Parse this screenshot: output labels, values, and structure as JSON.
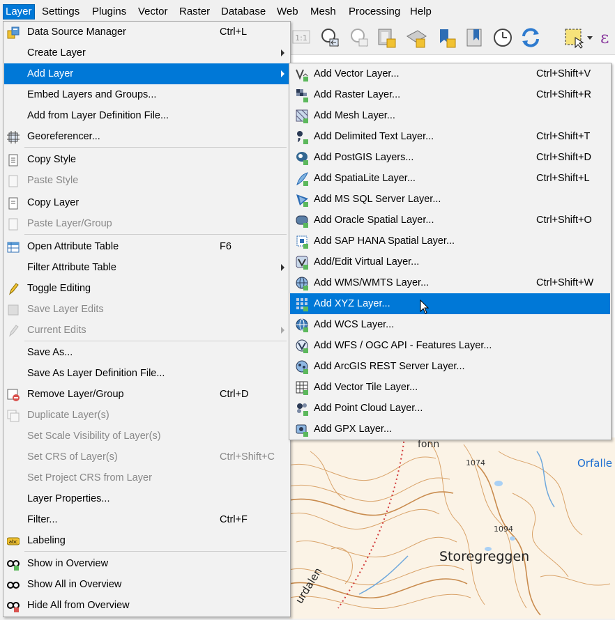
{
  "menubar": {
    "items": [
      {
        "label": "Layer",
        "active": true
      },
      {
        "label": "Settings"
      },
      {
        "label": "Plugins"
      },
      {
        "label": "Vector"
      },
      {
        "label": "Raster"
      },
      {
        "label": "Database"
      },
      {
        "label": "Web"
      },
      {
        "label": "Mesh"
      },
      {
        "label": "Processing"
      },
      {
        "label": "Help"
      }
    ]
  },
  "toolbar": {
    "icons": [
      "zoom-native-icon",
      "zoom-last-icon",
      "zoom-next-icon",
      "new-bookmark-icon",
      "show-bookmarks-icon",
      "new-spatial-bookmark-icon",
      "bookmarks-panel-icon",
      "temporal-controller-icon",
      "refresh-icon",
      "select-features-icon",
      "dropdown-icon",
      "expression-icon"
    ],
    "zoom_label": "1:1"
  },
  "layer_menu": {
    "items": [
      {
        "label": "Data Source Manager",
        "shortcut": "Ctrl+L",
        "icon": "data-source-manager-icon",
        "state": "normal"
      },
      {
        "label": "Create Layer",
        "submenu": true,
        "state": "normal"
      },
      {
        "label": "Add Layer",
        "submenu": true,
        "state": "highlighted"
      },
      {
        "label": "Embed Layers and Groups...",
        "state": "normal"
      },
      {
        "label": "Add from Layer Definition File...",
        "state": "normal"
      },
      {
        "label": "Georeferencer...",
        "icon": "georeferencer-icon",
        "state": "normal"
      },
      {
        "label": "Copy Style",
        "icon": "copy-style-icon",
        "state": "normal"
      },
      {
        "label": "Paste Style",
        "icon": "paste-style-icon",
        "state": "disabled"
      },
      {
        "label": "Copy Layer",
        "icon": "copy-layer-icon",
        "state": "normal"
      },
      {
        "label": "Paste Layer/Group",
        "icon": "paste-layer-icon",
        "state": "disabled"
      },
      {
        "label": "Open Attribute Table",
        "shortcut": "F6",
        "icon": "attribute-table-icon",
        "state": "normal"
      },
      {
        "label": "Filter Attribute Table",
        "submenu": true,
        "state": "normal"
      },
      {
        "label": "Toggle Editing",
        "icon": "pencil-icon",
        "state": "normal"
      },
      {
        "label": "Save Layer Edits",
        "icon": "save-edits-icon",
        "state": "disabled"
      },
      {
        "label": "Current Edits",
        "icon": "current-edits-icon",
        "submenu": true,
        "state": "disabled"
      },
      {
        "label": "Save As...",
        "state": "normal"
      },
      {
        "label": "Save As Layer Definition File...",
        "state": "normal"
      },
      {
        "label": "Remove Layer/Group",
        "shortcut": "Ctrl+D",
        "icon": "remove-layer-icon",
        "state": "normal"
      },
      {
        "label": "Duplicate Layer(s)",
        "icon": "duplicate-layer-icon",
        "state": "disabled"
      },
      {
        "label": "Set Scale Visibility of Layer(s)",
        "state": "disabled"
      },
      {
        "label": "Set CRS of Layer(s)",
        "shortcut": "Ctrl+Shift+C",
        "state": "disabled"
      },
      {
        "label": "Set Project CRS from Layer",
        "state": "disabled"
      },
      {
        "label": "Layer Properties...",
        "state": "normal"
      },
      {
        "label": "Filter...",
        "shortcut": "Ctrl+F",
        "state": "normal"
      },
      {
        "label": "Labeling",
        "icon": "labeling-icon",
        "state": "normal"
      },
      {
        "label": "Show in Overview",
        "icon": "show-overview-icon",
        "state": "normal"
      },
      {
        "label": "Show All in Overview",
        "icon": "show-all-overview-icon",
        "state": "normal"
      },
      {
        "label": "Hide All from Overview",
        "icon": "hide-all-overview-icon",
        "state": "normal"
      }
    ]
  },
  "add_layer_menu": {
    "items": [
      {
        "label": "Add Vector Layer...",
        "shortcut": "Ctrl+Shift+V",
        "icon": "vector-layer-icon"
      },
      {
        "label": "Add Raster Layer...",
        "shortcut": "Ctrl+Shift+R",
        "icon": "raster-layer-icon"
      },
      {
        "label": "Add Mesh Layer...",
        "icon": "mesh-layer-icon"
      },
      {
        "label": "Add Delimited Text Layer...",
        "shortcut": "Ctrl+Shift+T",
        "icon": "delimited-text-icon"
      },
      {
        "label": "Add PostGIS Layers...",
        "shortcut": "Ctrl+Shift+D",
        "icon": "postgis-icon"
      },
      {
        "label": "Add SpatiaLite Layer...",
        "shortcut": "Ctrl+Shift+L",
        "icon": "spatialite-icon"
      },
      {
        "label": "Add MS SQL Server Layer...",
        "icon": "mssql-icon"
      },
      {
        "label": "Add Oracle Spatial Layer...",
        "shortcut": "Ctrl+Shift+O",
        "icon": "oracle-icon"
      },
      {
        "label": "Add SAP HANA Spatial Layer...",
        "icon": "hana-icon"
      },
      {
        "label": "Add/Edit Virtual Layer...",
        "icon": "virtual-layer-icon"
      },
      {
        "label": "Add WMS/WMTS Layer...",
        "shortcut": "Ctrl+Shift+W",
        "icon": "wms-icon"
      },
      {
        "label": "Add XYZ Layer...",
        "icon": "xyz-layer-icon",
        "highlighted": true
      },
      {
        "label": "Add WCS Layer...",
        "icon": "wcs-icon"
      },
      {
        "label": "Add WFS / OGC API - Features Layer...",
        "icon": "wfs-icon"
      },
      {
        "label": "Add ArcGIS REST Server Layer...",
        "icon": "arcgis-icon"
      },
      {
        "label": "Add Vector Tile Layer...",
        "icon": "vector-tile-icon"
      },
      {
        "label": "Add Point Cloud Layer...",
        "icon": "point-cloud-icon"
      },
      {
        "label": "Add GPX Layer...",
        "icon": "gpx-icon"
      }
    ]
  },
  "map": {
    "labels": {
      "fonn": "fonn",
      "h1074": "1074",
      "h1094": "1094",
      "orfalle": "Orfalle",
      "storegreggen": "Storegreggen",
      "urdalen": "urdalen"
    }
  },
  "colors": {
    "accent": "#0078d7",
    "menu_bg": "#f2f2f2",
    "map_bg": "#fbf3e6",
    "contour": "#d9a36a"
  }
}
